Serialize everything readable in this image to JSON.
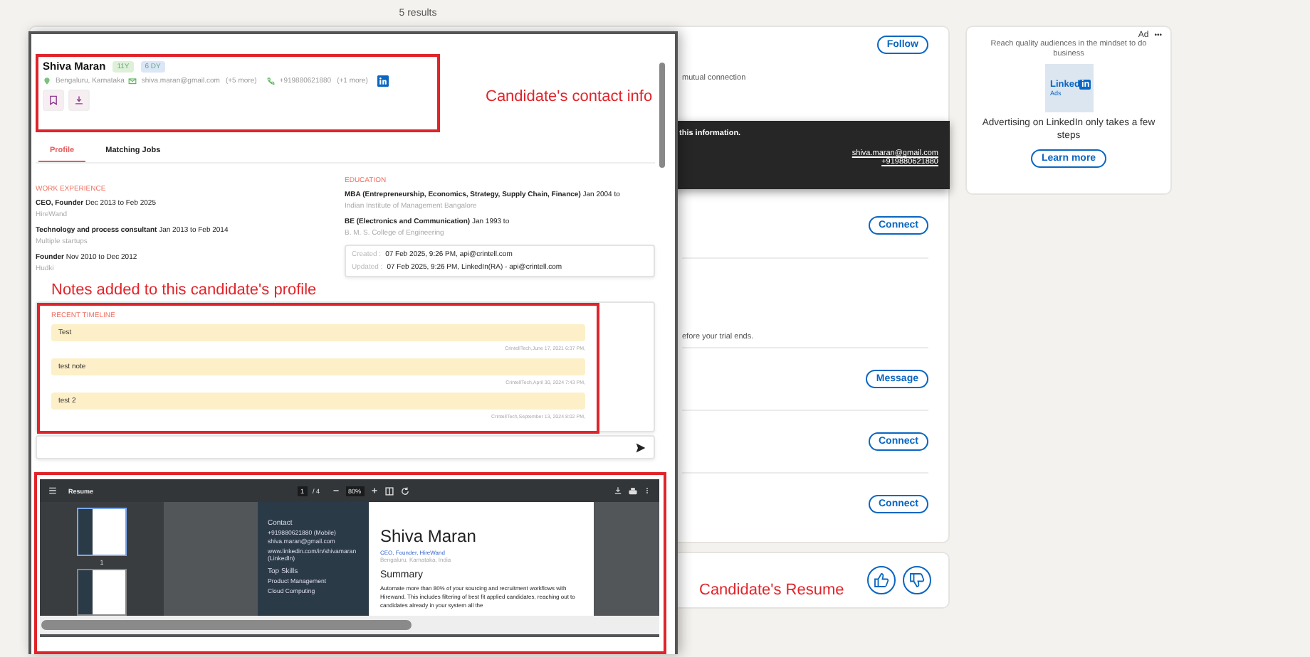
{
  "results_count": "5 results",
  "candidate": {
    "name": "Shiva Maran",
    "badges": [
      {
        "text": "11Y",
        "color": "#dff0d8"
      },
      {
        "text": "6 DY",
        "color": "#dbe6f7"
      }
    ],
    "location": "Bengaluru, Karnataka",
    "email": "shiva.maran@gmail.com",
    "email_more": "(+5 more)",
    "phone": "+919880621880",
    "phone_more": "(+1 more)"
  },
  "annotations": {
    "contact": "Candidate's contact info",
    "notes": "Notes added to this candidate's profile",
    "resume": "Candidate's Resume"
  },
  "tabs": [
    {
      "label": "Profile",
      "selected": true
    },
    {
      "label": "Matching Jobs",
      "selected": false
    }
  ],
  "work_experience": {
    "heading": "WORK EXPERIENCE",
    "items": [
      {
        "title": "**CEO, Founder** Dec 2013 to Feb 2025",
        "company": "HireWand"
      },
      {
        "title": "**Technology and process consultant** Jan 2013 to Feb 2014",
        "company": "Multiple startups"
      },
      {
        "title": "**Founder** Nov 2010 to Dec 2012",
        "company": "Hudki"
      }
    ]
  },
  "education": {
    "heading": "EDUCATION",
    "items": [
      {
        "title": "**MBA (Entrepreneurship, Economics, Strategy, Supply Chain, Finance)** Jan 2004 to",
        "school": "Indian Institute of Management Bangalore"
      },
      {
        "title": "**BE (Electronics and Communication)** Jan 1993 to",
        "school": "B. M. S. College of Engineering"
      }
    ]
  },
  "record": [
    {
      "label": "Created :",
      "value": "07 Feb 2025, 9:26 PM, api@crintell.com"
    },
    {
      "label": "Updated :",
      "value": "07 Feb 2025, 9:26 PM, LinkedIn(RA) - api@crintell.com"
    }
  ],
  "timeline": {
    "heading": "RECENT TIMELINE",
    "notes": [
      {
        "text": "Test",
        "meta": "CrintellTech,June 17, 2021 6:37 PM,"
      },
      {
        "text": "test note",
        "meta": "CrintellTech,April 30, 2024 7:43 PM,"
      },
      {
        "text": "test 2",
        "meta": "CrintellTech,September 13, 2024 8:02 PM,"
      }
    ]
  },
  "resume_viewer": {
    "title": "Resume",
    "page": "1",
    "page_total": "/ 4",
    "zoom": "80%",
    "thumbnails": [
      {
        "label": "1",
        "selected": true
      },
      {
        "selected": false
      }
    ],
    "sidebar": {
      "contact_heading": "Contact",
      "contact_lines": [
        "+919880621880 (Mobile)",
        "shiva.maran@gmail.com",
        "www.linkedin.com/in/shivamaran (LinkedIn)"
      ],
      "skills_heading": "Top Skills",
      "skills": [
        "Product Management",
        "Cloud Computing"
      ]
    },
    "name": "Shiva Maran",
    "headline": "CEO, Founder, HireWand",
    "location": "Bengaluru, Karnataka, India",
    "summary_heading": "Summary",
    "summary": "Automate more than 80% of your sourcing and recruitment workflows with Hirewand. This includes filtering of best fit applied candidates, reaching out to candidates already in your system all the"
  },
  "feed": {
    "follow": "Follow",
    "mutual": "mutual connection",
    "tooltip": {
      "text": "this information.",
      "email": "shiva.maran@gmail.com",
      "phone": "+919880621880"
    },
    "rows": [
      {
        "kind": "button",
        "label": "Connect"
      },
      {
        "kind": "text",
        "label": "efore your trial ends."
      },
      {
        "kind": "button",
        "label": "Message"
      },
      {
        "kind": "button",
        "label": "Connect"
      },
      {
        "kind": "button",
        "label": "Connect"
      }
    ]
  },
  "ad": {
    "tag": "Ad",
    "more": "•••",
    "tagline": "Reach quality audiences in the mindset to do business",
    "logo_word": "Linked",
    "logo_in": "in",
    "logo_sub": "Ads",
    "headline": "Advertising on LinkedIn only takes a few steps",
    "cta": "Learn more"
  }
}
